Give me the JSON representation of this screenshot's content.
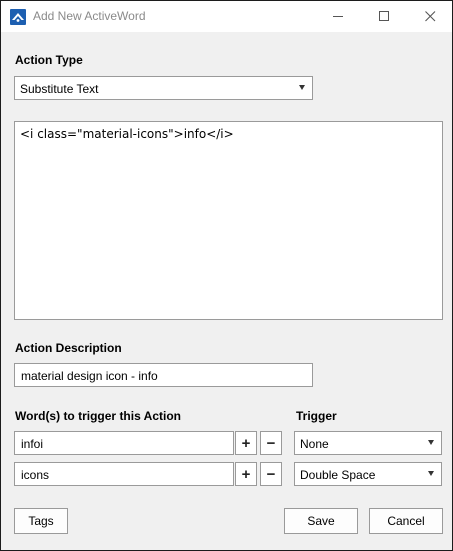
{
  "window": {
    "title": "Add New ActiveWord"
  },
  "action_type": {
    "label": "Action Type",
    "selected": "Substitute Text"
  },
  "substitute_text": {
    "value": "<i class=\"material-icons\">info</i>"
  },
  "action_description": {
    "label": "Action Description",
    "value": "material design icon - info"
  },
  "triggers": {
    "words_label": "Word(s) to trigger this Action",
    "trigger_label": "Trigger",
    "rows": [
      {
        "word": "infoi",
        "add": "+",
        "remove": "−",
        "trigger": "None"
      },
      {
        "word": "icons",
        "add": "+",
        "remove": "−",
        "trigger": "Double Space"
      }
    ]
  },
  "footer": {
    "tags": "Tags",
    "save": "Save",
    "cancel": "Cancel"
  },
  "icons": {
    "app": "activewords-logo-icon",
    "minimize": "minimize-icon",
    "maximize": "maximize-icon",
    "close": "close-icon"
  }
}
